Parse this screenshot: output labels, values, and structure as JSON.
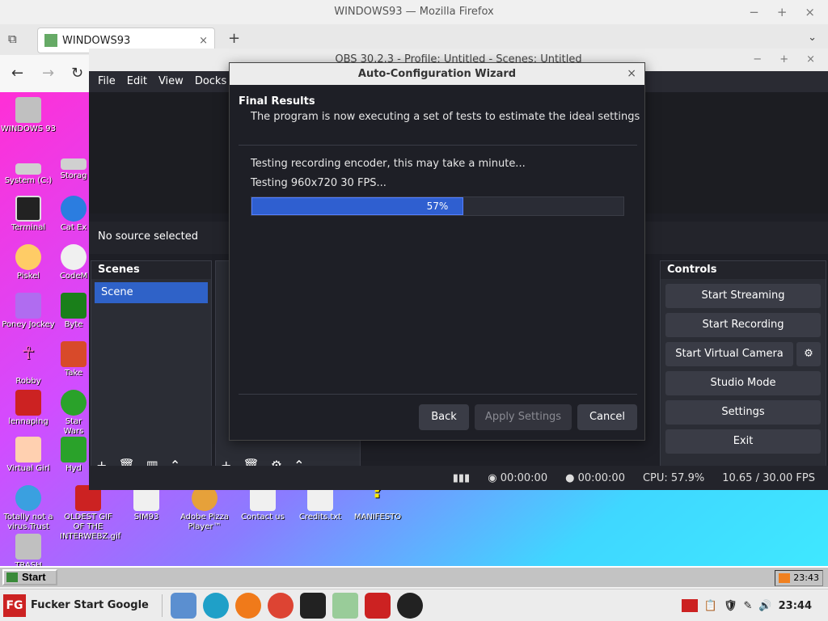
{
  "firefox": {
    "window_title": "WINDOWS93 — Mozilla Firefox",
    "tab_title": "WINDOWS93"
  },
  "desktop": {
    "icons": [
      {
        "label": "WINDOWS 93",
        "color": "#c0c0c0"
      },
      {
        "label": "System (C:)",
        "color": "#d0d0d0"
      },
      {
        "label": "Terminal",
        "color": "#222"
      },
      {
        "label": "Piskel",
        "color": "#ffcc66"
      },
      {
        "label": "Poney Jockey",
        "color": "#b06cf0"
      },
      {
        "label": "Robby",
        "color": "#ff66cc"
      },
      {
        "label": "lennaping",
        "color": "#cc2222"
      },
      {
        "label": "Virtual Girl",
        "color": "#ffd0b0"
      },
      {
        "label": "Totally not a virus.Trust me...",
        "color": "#3aa0e0"
      },
      {
        "label": "OLDEST GIF OF THE INTERWEBZ.gif",
        "color": "#cc2222"
      },
      {
        "label": "SIM93",
        "color": "#f0f0f0"
      },
      {
        "label": "Adobe Pizza Player™",
        "color": "#e6a13a"
      },
      {
        "label": "Contact us",
        "color": "#f0f0f0"
      },
      {
        "label": "Credits.txt",
        "color": "#f0f0f0"
      },
      {
        "label": "MANIFESTO",
        "color": "#ffea00"
      },
      {
        "label": "TRASH",
        "color": "#c0c0c0"
      },
      {
        "label": "Storag",
        "color": "#d0d0d0"
      },
      {
        "label": "Cat Ex",
        "color": "#2b7de0"
      },
      {
        "label": "CodeM",
        "color": "#f0f0f0"
      },
      {
        "label": "Byte",
        "color": "#1a7f1a"
      },
      {
        "label": "Take",
        "color": "#d84a2a"
      },
      {
        "label": "Star Wars",
        "color": "#2aa22a"
      },
      {
        "label": "Hyd",
        "color": "#2aa22a"
      }
    ],
    "taskbar": {
      "start_label": "Start",
      "clock": "23:43"
    }
  },
  "obs": {
    "title": "OBS 30.2.3 - Profile: Untitled - Scenes: Untitled",
    "menu": [
      "File",
      "Edit",
      "View",
      "Docks"
    ],
    "no_source": "No source selected",
    "scenes_title": "Scenes",
    "scene_item": "Scene",
    "controls_title": "Controls",
    "controls": {
      "start_streaming": "Start Streaming",
      "start_recording": "Start Recording",
      "start_virtual_camera": "Start Virtual Camera",
      "studio_mode": "Studio Mode",
      "settings": "Settings",
      "exit": "Exit"
    },
    "status": {
      "stream_time": "00:00:00",
      "record_time": "00:00:00",
      "cpu": "CPU: 57.9%",
      "fps": "10.65 / 30.00 FPS"
    }
  },
  "wizard": {
    "title": "Auto-Configuration Wizard",
    "heading": "Final Results",
    "subheading": "The program is now executing a set of tests to estimate the ideal settings",
    "line1": "Testing recording encoder, this may take a minute...",
    "line2": "Testing 960x720 30 FPS...",
    "progress_pct": 57,
    "progress_label": "57%",
    "back_label": "Back",
    "apply_label": "Apply Settings",
    "cancel_label": "Cancel"
  },
  "panel": {
    "start_label": "Fucker Start Google",
    "clock": "23:44"
  }
}
